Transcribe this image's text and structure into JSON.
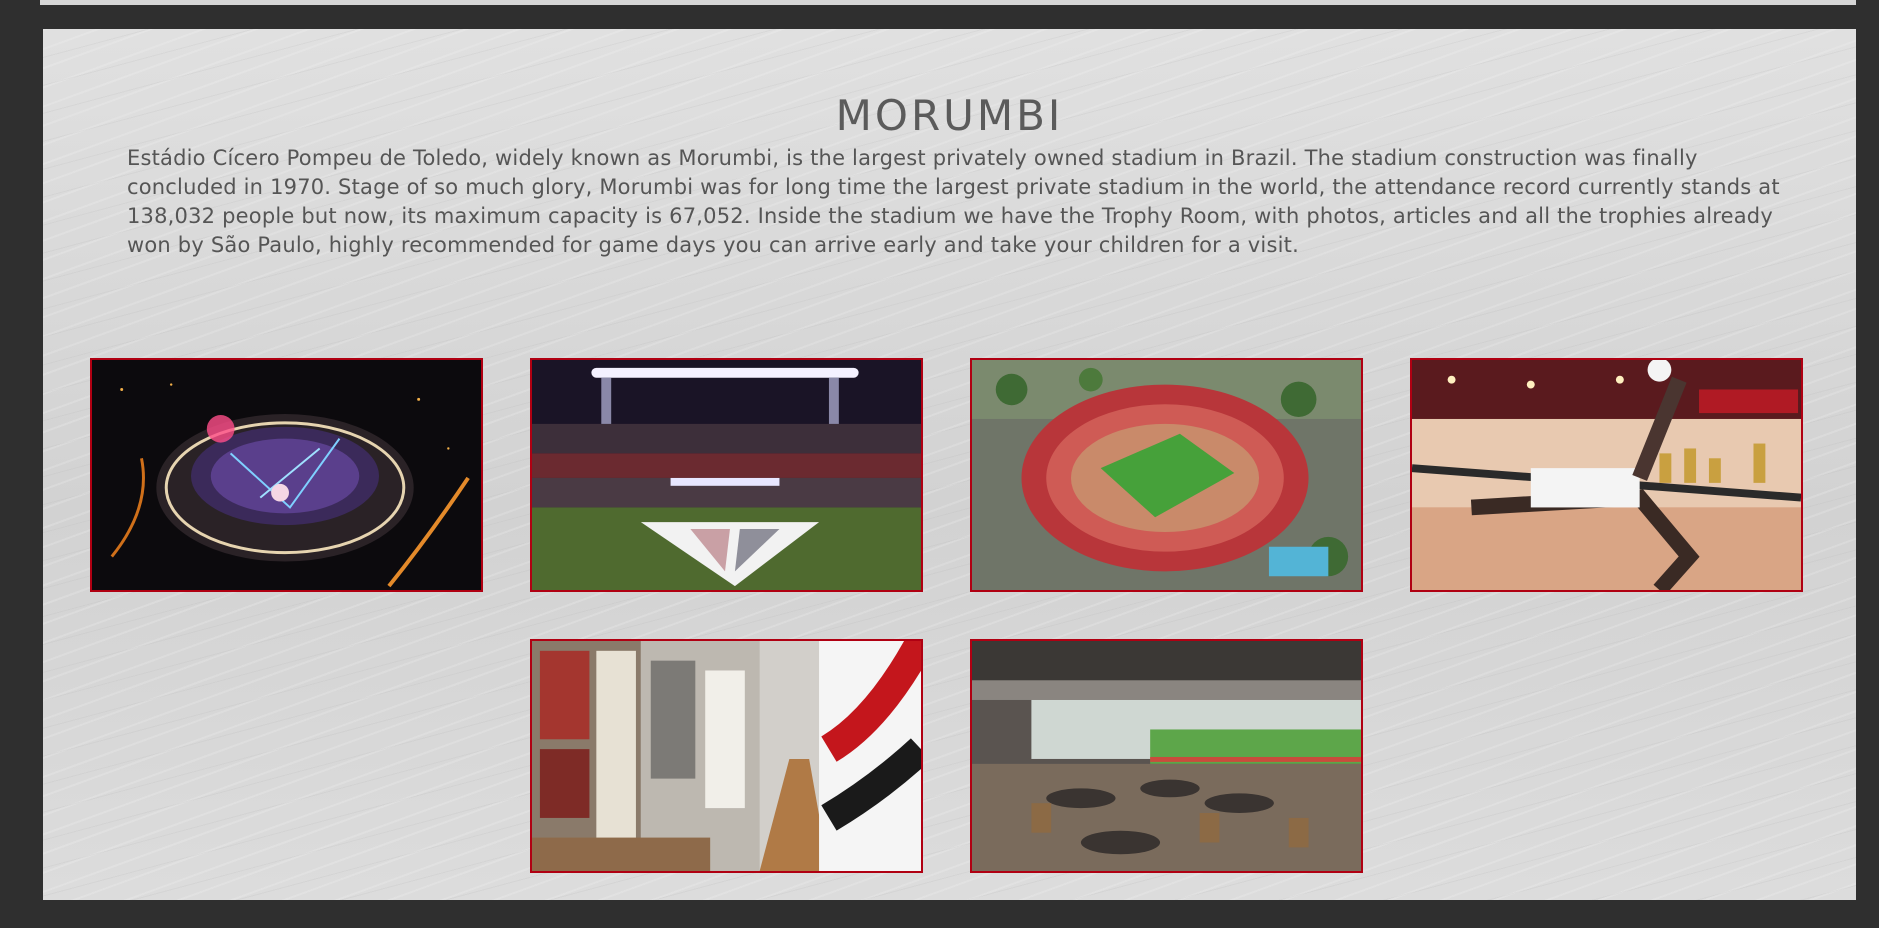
{
  "page": {
    "title": "MORUMBI",
    "description": "Estádio Cícero Pompeu de Toledo, widely known as Morumbi, is the largest privately owned stadium in Brazil. The stadium construction was finally concluded in 1970. Stage of so much glory, Morumbi was for long time the largest private stadium in the world, the attendance record currently stands at 138,032 people but now, its maximum capacity is 67,052. Inside the stadium we have the Trophy Room, with photos, articles and all the trophies already won by São Paulo, highly recommended for game days you can arrive early and take your children for a visit."
  },
  "gallery": {
    "items": [
      {
        "subject": "stadium-night-aerial"
      },
      {
        "subject": "stadium-floodlights-field"
      },
      {
        "subject": "stadium-daytime-aerial"
      },
      {
        "subject": "trophy-room-statue"
      },
      {
        "subject": "newspaper-corridor"
      },
      {
        "subject": "stadium-restaurant"
      }
    ]
  },
  "colors": {
    "background": "#2f2f2f",
    "panel": "#d9d9d9",
    "title": "#5b5b5b",
    "text": "#555555",
    "photo_border": "#b00012"
  }
}
